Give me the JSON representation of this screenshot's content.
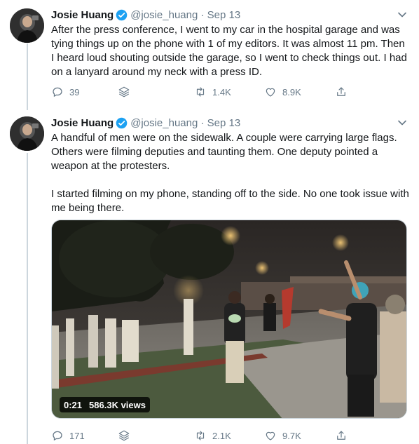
{
  "tweets": [
    {
      "name": "Josie Huang",
      "handle": "@josie_huang",
      "date": "Sep 13",
      "text": "After the press conference, I went to my car in the hospital garage and was tying things up on the phone with 1 of my editors. It was almost 11 pm. Then I heard loud shouting outside the garage, so I went to check things out. I had on a lanyard around my neck with a press ID.",
      "replies": "39",
      "retweets": "1.4K",
      "likes": "8.9K"
    },
    {
      "name": "Josie Huang",
      "handle": "@josie_huang",
      "date": "Sep 13",
      "text_p1": "A handful of men were on the sidewalk. A couple were carrying large flags. Others were filming deputies and taunting them. One deputy pointed a weapon at the protesters.",
      "text_p2": "I started filming on my phone, standing off to the side. No one took issue with me being there.",
      "video_duration": "0:21",
      "video_views": "586.3K views",
      "replies": "171",
      "retweets": "2.1K",
      "likes": "9.7K"
    }
  ],
  "colors": {
    "verified": "#1da1f2",
    "muted": "#657786",
    "text": "#14171a"
  },
  "icons": [
    "verified-badge-icon",
    "chevron-down-icon",
    "reply-icon",
    "stack-icon",
    "retweet-icon",
    "like-icon",
    "share-icon"
  ]
}
